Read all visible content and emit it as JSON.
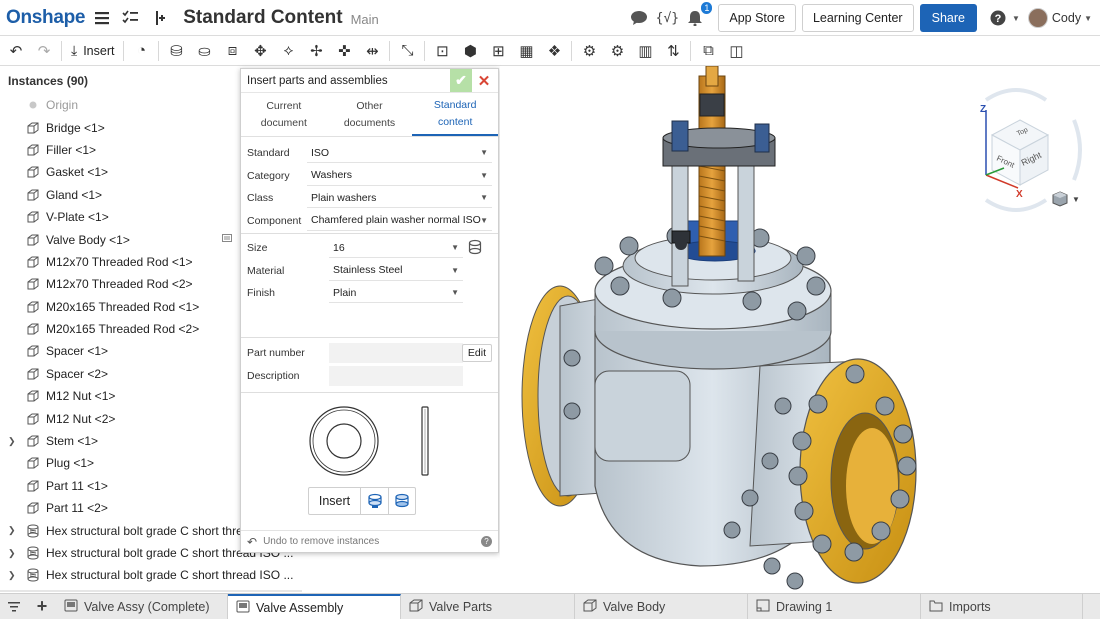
{
  "app": {
    "logo": "Onshape",
    "doc_title": "Standard Content",
    "branch": "Main",
    "notifications": "1",
    "app_store": "App Store",
    "learning_center": "Learning Center",
    "share": "Share",
    "user": "Cody"
  },
  "toolbar": {
    "insert_label": "Insert"
  },
  "instances": {
    "header": "Instances (90)",
    "items": [
      {
        "label": "Origin",
        "type": "origin",
        "expand": false
      },
      {
        "label": "Bridge <1>",
        "type": "part",
        "expand": false
      },
      {
        "label": "Filler <1>",
        "type": "part",
        "expand": false
      },
      {
        "label": "Gasket <1>",
        "type": "part",
        "expand": false
      },
      {
        "label": "Gland <1>",
        "type": "part",
        "expand": false
      },
      {
        "label": "V-Plate <1>",
        "type": "part",
        "expand": false
      },
      {
        "label": "Valve Body <1>",
        "type": "part",
        "expand": false,
        "extra": true
      },
      {
        "label": "M12x70 Threaded Rod <1>",
        "type": "part",
        "expand": false
      },
      {
        "label": "M12x70 Threaded Rod <2>",
        "type": "part",
        "expand": false
      },
      {
        "label": "M20x165 Threaded Rod <1>",
        "type": "part",
        "expand": false
      },
      {
        "label": "M20x165 Threaded Rod <2>",
        "type": "part",
        "expand": false
      },
      {
        "label": "Spacer <1>",
        "type": "part",
        "expand": false
      },
      {
        "label": "Spacer <2>",
        "type": "part",
        "expand": false
      },
      {
        "label": "M12 Nut <1>",
        "type": "part",
        "expand": false
      },
      {
        "label": "M12 Nut <2>",
        "type": "part",
        "expand": false
      },
      {
        "label": "Stem <1>",
        "type": "part",
        "expand": true
      },
      {
        "label": "Plug <1>",
        "type": "part",
        "expand": false
      },
      {
        "label": "Part 11 <1>",
        "type": "part",
        "expand": false
      },
      {
        "label": "Part 11 <2>",
        "type": "part",
        "expand": false
      },
      {
        "label": "Hex structural bolt grade C short thread",
        "type": "std",
        "expand": true
      },
      {
        "label": "Hex structural bolt grade C short thread ISO ...",
        "type": "std",
        "expand": true
      },
      {
        "label": "Hex structural bolt grade C short thread ISO ...",
        "type": "std",
        "expand": true
      }
    ]
  },
  "dialog": {
    "title": "Insert parts and assemblies",
    "tabs": [
      {
        "line1": "Current",
        "line2": "document"
      },
      {
        "line1": "Other",
        "line2": "documents"
      },
      {
        "line1": "Standard",
        "line2": "content"
      }
    ],
    "standard_label": "Standard",
    "standard_value": "ISO",
    "category_label": "Category",
    "category_value": "Washers",
    "class_label": "Class",
    "class_value": "Plain washers",
    "component_label": "Component",
    "component_value": "Chamfered plain washer normal ISO",
    "size_label": "Size",
    "size_value": "16",
    "material_label": "Material",
    "material_value": "Stainless Steel",
    "finish_label": "Finish",
    "finish_value": "Plain",
    "part_number_label": "Part number",
    "edit_label": "Edit",
    "description_label": "Description",
    "insert_label": "Insert",
    "undo_label": "Undo to remove instances"
  },
  "viewcube": {
    "top": "Top",
    "front": "Front",
    "right": "Right",
    "axis_x": "X",
    "axis_z": "Z"
  },
  "bottom_tabs": [
    {
      "label": "Valve Assy (Complete)",
      "icon": "assembly-icon",
      "active": false
    },
    {
      "label": "Valve Assembly",
      "icon": "assembly-icon",
      "active": true
    },
    {
      "label": "Valve Parts",
      "icon": "part-studio-icon",
      "active": false
    },
    {
      "label": "Valve Body",
      "icon": "part-studio-icon",
      "active": false
    },
    {
      "label": "Drawing 1",
      "icon": "drawing-icon",
      "active": false
    },
    {
      "label": "Imports",
      "icon": "folder-icon",
      "active": false
    }
  ],
  "colors": {
    "brand_blue": "#1d64b6",
    "flange_gold": "#e3a81f",
    "body_steel": "#c9d3db",
    "dark_metal": "#3a3f46",
    "plug_blue": "#2f5fb0",
    "stem_bronze": "#c98a2a"
  }
}
